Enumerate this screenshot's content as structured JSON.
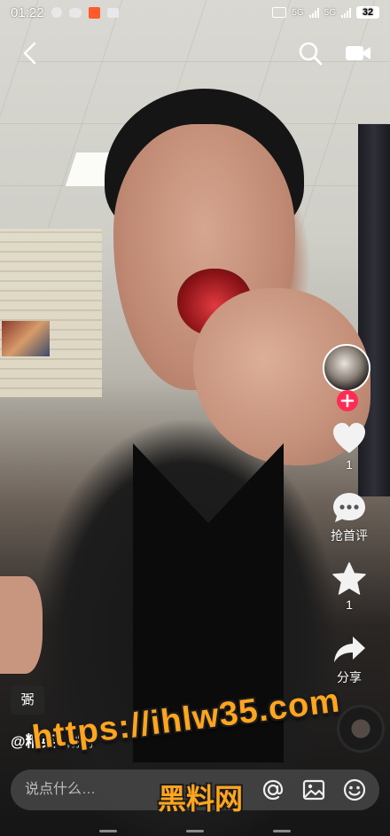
{
  "status_bar": {
    "time": "01:22",
    "network_1": "5G",
    "network_2": "5G",
    "battery": "32"
  },
  "top_nav": {
    "back_icon": "chevron-left-icon",
    "search_icon": "search-icon",
    "camera_icon": "video-camera-icon"
  },
  "rail": {
    "follow_icon": "plus-icon",
    "like_count": "1",
    "comment_label": "抢首评",
    "favorite_count": "1",
    "share_label": "分享"
  },
  "caption": {
    "effect_tag": "弻",
    "author": "@精英",
    "separator": "·",
    "time": "刚刚"
  },
  "comment_bar": {
    "placeholder": "说点什么…"
  },
  "watermark": {
    "url": "https://ihlw35.com",
    "name": "黑料网"
  },
  "colors": {
    "accent": "#fe2c55",
    "watermark": "#ffa51f"
  }
}
